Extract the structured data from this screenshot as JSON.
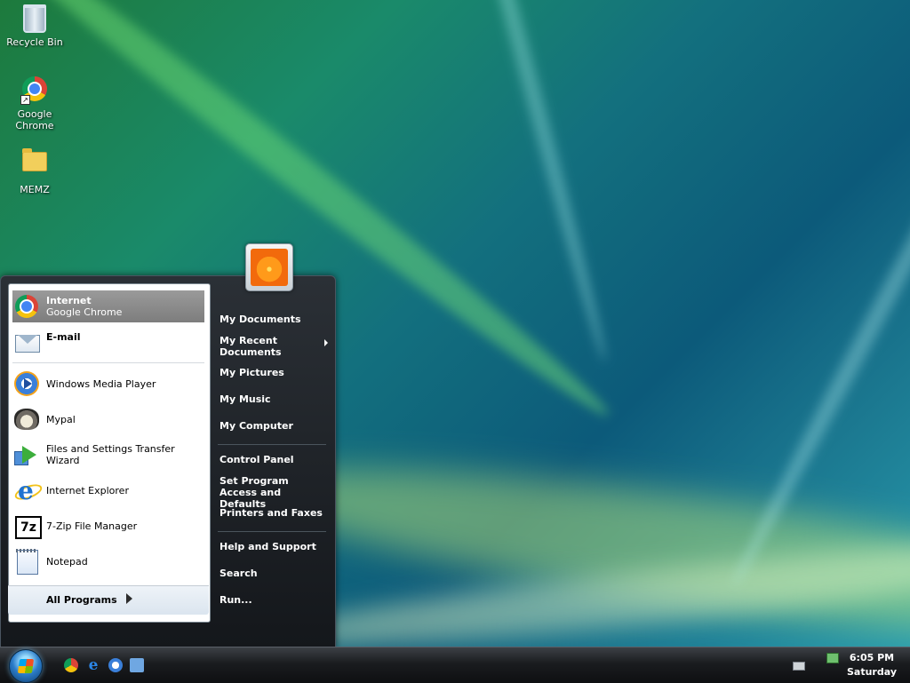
{
  "desktop": {
    "icons": [
      {
        "label": "Recycle Bin",
        "icon": "recycle-bin-icon"
      },
      {
        "label": "Google Chrome",
        "icon": "chrome-icon"
      },
      {
        "label": "MEMZ",
        "icon": "folder-icon"
      }
    ]
  },
  "start_menu": {
    "pinned": [
      {
        "line1": "Internet",
        "line2": "Google Chrome",
        "icon": "chrome-icon"
      },
      {
        "line1": "E-mail",
        "icon": "email-icon"
      }
    ],
    "recent": [
      {
        "label": "Windows Media Player",
        "icon": "windows-media-player-icon"
      },
      {
        "label": "Mypal",
        "icon": "mypal-icon"
      },
      {
        "label": "Files and Settings Transfer Wizard",
        "icon": "transfer-wizard-icon"
      },
      {
        "label": "Internet Explorer",
        "icon": "internet-explorer-icon"
      },
      {
        "label": "7-Zip File Manager",
        "icon": "7zip-icon",
        "icon_text": "7z"
      },
      {
        "label": "Notepad",
        "icon": "notepad-icon"
      }
    ],
    "all_programs": "All Programs",
    "right": {
      "group1": [
        "My Documents",
        "My Recent Documents",
        "My Pictures",
        "My Music",
        "My Computer"
      ],
      "group2": [
        "Control Panel",
        "Set Program Access and Defaults",
        "Printers and Faxes"
      ],
      "group3": [
        "Help and Support",
        "Search",
        "Run..."
      ]
    }
  },
  "taskbar": {
    "clock_time": "6:05 PM",
    "clock_day": "Saturday"
  },
  "colors": {
    "highlight": "#8a8a8a",
    "menu_dark": "#1b1e22"
  }
}
